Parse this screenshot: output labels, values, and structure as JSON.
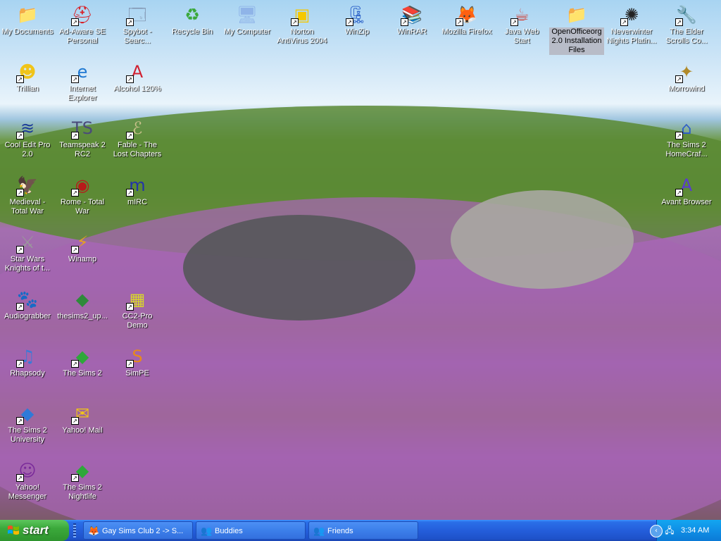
{
  "desktop": {
    "icons": [
      {
        "label": "My Documents",
        "glyph": "📁",
        "color": "#f2c94c",
        "shortcut": false
      },
      {
        "label": "Ad-Aware SE Personal",
        "glyph": "⛑",
        "color": "#d8232a",
        "shortcut": true
      },
      {
        "label": "Spybot - Searc...",
        "glyph": "🗔",
        "color": "#7b8ca8",
        "shortcut": true
      },
      {
        "label": "Recycle Bin",
        "glyph": "♻",
        "color": "#3aa83a",
        "shortcut": false
      },
      {
        "label": "My Computer",
        "glyph": "🖥",
        "color": "#8fb4e8",
        "shortcut": false
      },
      {
        "label": "Norton AntiVirus 2004",
        "glyph": "▣",
        "color": "#f5c800",
        "shortcut": true
      },
      {
        "label": "WinZip",
        "glyph": "🗜",
        "color": "#2d62c8",
        "shortcut": true
      },
      {
        "label": "WinRAR",
        "glyph": "📚",
        "color": "#8a3a9a",
        "shortcut": true
      },
      {
        "label": "Mozilla Firefox",
        "glyph": "🦊",
        "color": "#e5761f",
        "shortcut": true
      },
      {
        "label": "Java Web Start",
        "glyph": "☕",
        "color": "#d33a2e",
        "shortcut": true
      },
      {
        "label": "OpenOfficeorg 2.0 Installation Files",
        "glyph": "📁",
        "color": "#f2d58a",
        "shortcut": false
      },
      {
        "label": "Neverwinter Nights Platin...",
        "glyph": "✺",
        "color": "#222222",
        "shortcut": true
      },
      {
        "label": "The Elder Scrolls Co...",
        "glyph": "🔧",
        "color": "#c81e2a",
        "shortcut": true
      },
      {
        "label": "Trillian",
        "glyph": "☻",
        "color": "#f0c419",
        "shortcut": true
      },
      {
        "label": "Internet Explorer",
        "glyph": "e",
        "color": "#1e78d2",
        "shortcut": true
      },
      {
        "label": "Alcohol 120%",
        "glyph": "A",
        "color": "#d12030",
        "shortcut": true
      },
      {
        "label": "Morrowind",
        "glyph": "✦",
        "color": "#b08a2a",
        "shortcut": true
      },
      {
        "label": "Cool Edit Pro 2.0",
        "glyph": "≋",
        "color": "#1a3a9a",
        "shortcut": true
      },
      {
        "label": "Teamspeak 2 RC2",
        "glyph": "TS",
        "color": "#4a4a7a",
        "shortcut": true
      },
      {
        "label": "Fable - The Lost Chapters",
        "glyph": "ℰ",
        "color": "#c8c08a",
        "shortcut": true
      },
      {
        "label": "The Sims 2 HomeCraf...",
        "glyph": "⌂",
        "color": "#2e5ec8",
        "shortcut": true
      },
      {
        "label": "Medieval - Total War",
        "glyph": "🦅",
        "color": "#ffffff",
        "shortcut": true
      },
      {
        "label": "Rome - Total War",
        "glyph": "◉",
        "color": "#b81a1a",
        "shortcut": true
      },
      {
        "label": "mIRC",
        "glyph": "m",
        "color": "#2233aa",
        "shortcut": true
      },
      {
        "label": "Avant Browser",
        "glyph": "A",
        "color": "#5a3ad2",
        "shortcut": true
      },
      {
        "label": "Star Wars Knights of t...",
        "glyph": "⚔",
        "color": "#9a9a9a",
        "shortcut": true
      },
      {
        "label": "Winamp",
        "glyph": "⚡",
        "color": "#e6a21e",
        "shortcut": true
      },
      {
        "label": "Audiograbber",
        "glyph": "🐾",
        "color": "#a06a2a",
        "shortcut": true
      },
      {
        "label": "thesims2_up...",
        "glyph": "◆",
        "color": "#2e8a3a",
        "shortcut": false
      },
      {
        "label": "CC2-Pro Demo",
        "glyph": "▦",
        "color": "#d8d82a",
        "shortcut": true
      },
      {
        "label": "Rhapsody",
        "glyph": "♫",
        "color": "#3a7ad8",
        "shortcut": true
      },
      {
        "label": "The Sims 2",
        "glyph": "◆",
        "color": "#2ea83a",
        "shortcut": true
      },
      {
        "label": "SimPE",
        "glyph": "S",
        "color": "#e88a1a",
        "shortcut": true
      },
      {
        "label": "The Sims 2 University",
        "glyph": "◆",
        "color": "#2e7ad8",
        "shortcut": true
      },
      {
        "label": "Yahoo! Mail",
        "glyph": "✉",
        "color": "#f0c419",
        "shortcut": true
      },
      {
        "label": "Yahoo! Messenger",
        "glyph": "☺",
        "color": "#7a2a9a",
        "shortcut": true
      },
      {
        "label": "The Sims 2 Nightlife",
        "glyph": "◆",
        "color": "#2ea83a",
        "shortcut": true
      }
    ]
  },
  "taskbar": {
    "start_label": "start",
    "tasks": [
      {
        "label": "Gay Sims Club 2 -> S...",
        "glyph": "🦊"
      },
      {
        "label": "Buddies",
        "glyph": "👥"
      },
      {
        "label": "Friends",
        "glyph": "👥"
      }
    ],
    "clock": "3:34 AM"
  }
}
